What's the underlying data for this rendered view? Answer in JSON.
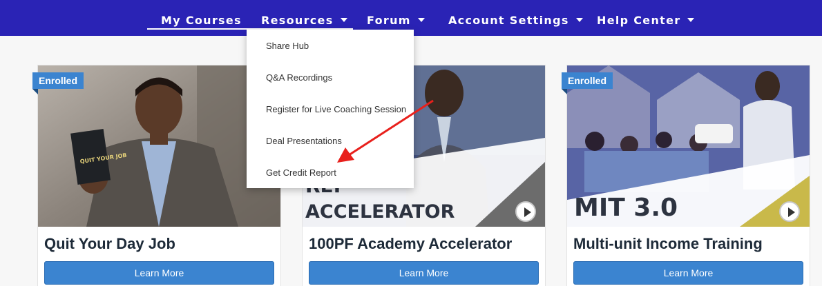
{
  "nav": {
    "items": [
      {
        "label": "My Courses",
        "dropdown": false
      },
      {
        "label": "Resources",
        "dropdown": true
      },
      {
        "label": "Forum",
        "dropdown": true
      },
      {
        "label": "Account Settings",
        "dropdown": true
      },
      {
        "label": "Help Center",
        "dropdown": true
      }
    ]
  },
  "resources_menu": {
    "items": [
      "Share Hub",
      "Q&A Recordings",
      "Register for Live Coaching Session",
      "Deal Presentations",
      "Get Credit Report"
    ]
  },
  "courses": [
    {
      "badge": "Enrolled",
      "title": "Quit Your Day Job",
      "button": "Learn More",
      "book_text": "QUIT YOUR JOB"
    },
    {
      "badge": "",
      "title": "100PF Academy Accelerator",
      "button": "Learn More",
      "image_text_1": "REI",
      "image_text_2": "ACCELERATOR"
    },
    {
      "badge": "Enrolled",
      "title": "Multi-unit Income Training",
      "button": "Learn More",
      "image_text": "MIT 3.0"
    }
  ],
  "colors": {
    "nav_bg": "#2a23b5",
    "button": "#3b84d0",
    "arrow": "#e8201c",
    "accent_yellow": "#c9b94a"
  }
}
